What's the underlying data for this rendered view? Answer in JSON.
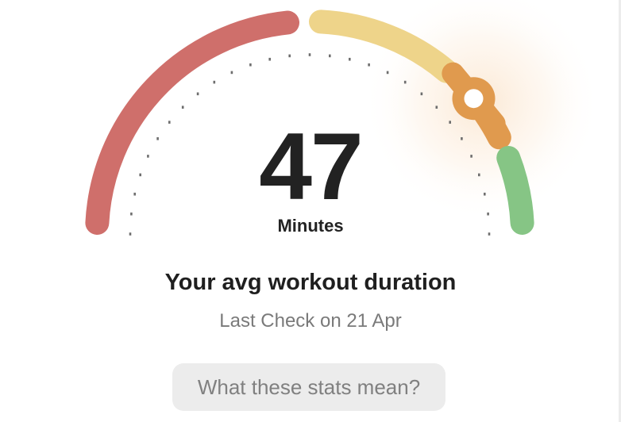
{
  "gauge": {
    "value": "47",
    "unit": "Minutes",
    "level": 0.78,
    "segments": [
      {
        "name": "low",
        "color": "#cf6f6b"
      },
      {
        "name": "below-average",
        "color": "#eed48a"
      },
      {
        "name": "above-average",
        "color": "#e09a4e"
      },
      {
        "name": "high",
        "color": "#86c585"
      }
    ],
    "tick_color": "#6e6e6e"
  },
  "card": {
    "title": "Your avg workout duration",
    "subtitle": "Last Check on 21 Apr"
  },
  "button": {
    "label": "What these stats mean?"
  }
}
